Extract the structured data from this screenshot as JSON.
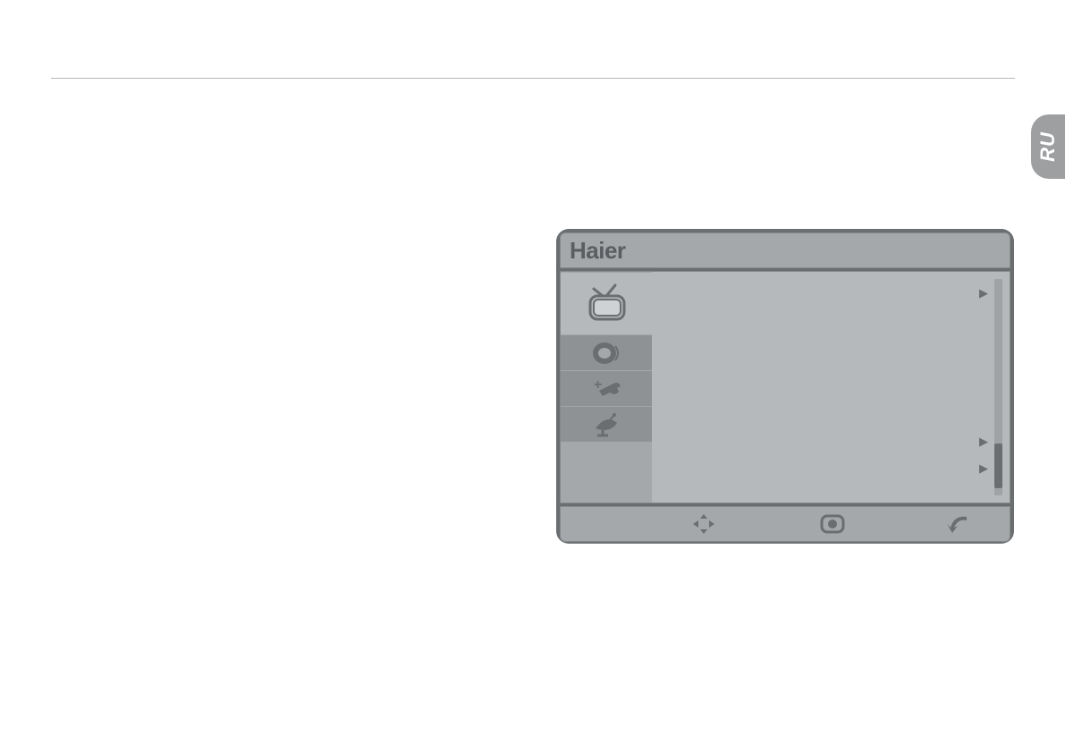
{
  "page": {
    "language_tab": "RU",
    "osd": {
      "brand": "Haier",
      "sidebar": [
        {
          "name": "tv-icon",
          "active": true
        },
        {
          "name": "speaker-icon",
          "active": false
        },
        {
          "name": "wrench-icon",
          "active": false
        },
        {
          "name": "satellite-icon",
          "active": false
        }
      ],
      "footer_icons": [
        "move-icon",
        "enter-icon",
        "back-icon"
      ]
    }
  }
}
